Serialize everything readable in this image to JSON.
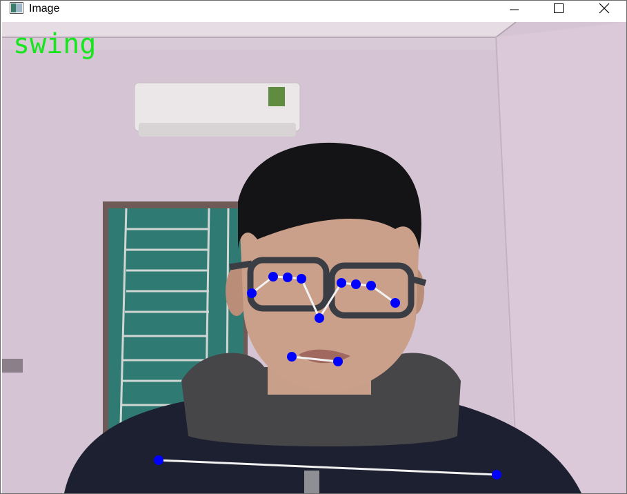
{
  "window": {
    "title": "Image"
  },
  "controls": {
    "minimize": "minimize-icon",
    "maximize": "maximize-icon",
    "close": "close-icon"
  },
  "overlay": {
    "action_label": "swing",
    "label_color": "#17e51d",
    "keypoint_color": "#0000ff",
    "skeleton_color": "#f2f2f2"
  },
  "keypoints": {
    "face": [
      {
        "id": "right-ear"
      },
      {
        "id": "right-eye-outer"
      },
      {
        "id": "right-eye"
      },
      {
        "id": "right-eye-inner"
      },
      {
        "id": "nose"
      },
      {
        "id": "left-eye-inner"
      },
      {
        "id": "left-eye"
      },
      {
        "id": "left-eye-outer"
      },
      {
        "id": "left-ear"
      },
      {
        "id": "mouth-right"
      },
      {
        "id": "mouth-left"
      }
    ],
    "body": [
      {
        "id": "right-shoulder"
      },
      {
        "id": "left-shoulder"
      }
    ]
  }
}
